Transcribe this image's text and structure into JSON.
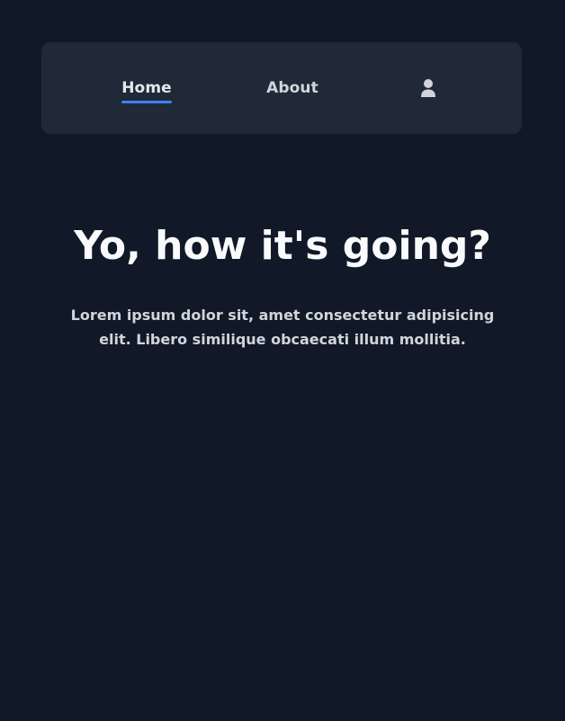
{
  "nav": {
    "items": [
      {
        "label": "Home",
        "active": true
      },
      {
        "label": "About",
        "active": false
      }
    ],
    "profile_icon": "user-icon"
  },
  "hero": {
    "title": "Yo, how it's going?",
    "description": "Lorem ipsum dolor sit, amet consectetur adipisicing elit. Libero similique obcaecati illum mollitia."
  },
  "colors": {
    "background": "#111827",
    "navbar": "#1f2937",
    "accent": "#3b82f6",
    "text_primary": "#f9fafb",
    "text_secondary": "#d1d5db"
  }
}
